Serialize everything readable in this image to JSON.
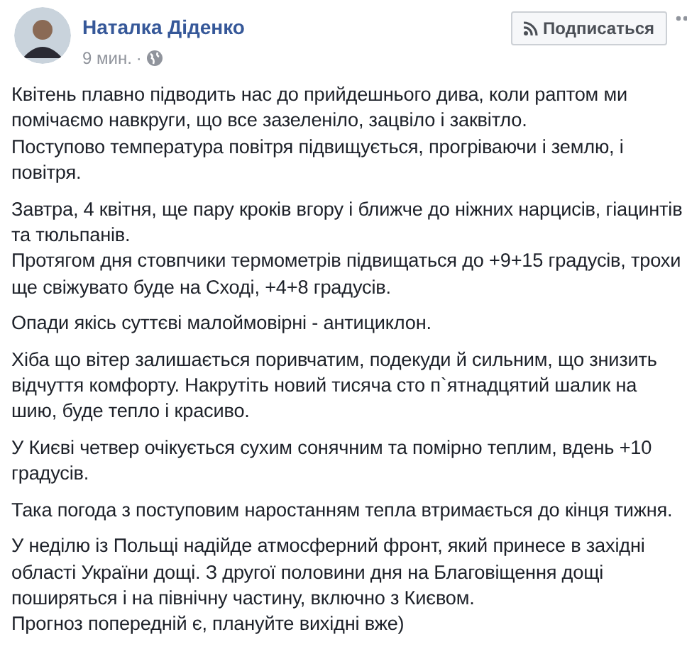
{
  "post": {
    "author": "Наталка Діденко",
    "time": "9 мин.",
    "separator": "·",
    "follow_button": "Подписаться",
    "paragraphs": [
      {
        "lines": [
          "Квітень плавно підводить нас до прийдешнього дива, коли раптом ми помічаємо навкруги, що все зазеленіло, зацвіло і заквітло.",
          "Поступово температура повітря підвищується, прогріваючи і землю, і повітря."
        ]
      },
      {
        "lines": [
          "Завтра, 4 квітня, ще пару кроків вгору і ближче до ніжних нарцисів, гіацинтів та тюльпанів.",
          "Протягом дня стовпчики термометрів підвищаться до +9+15 градусів, трохи ще свіжувато буде на Сході, +4+8 градусів."
        ]
      },
      {
        "lines": [
          "Опади якісь суттєві малоймовірні - антициклон."
        ]
      },
      {
        "lines": [
          "Хіба що вітер залишається поривчатим, подекуди й сильним, що знизить відчуття комфорту. Накрутіть новий тисяча сто п`ятнадцятий шалик на шию, буде тепло і красиво."
        ]
      },
      {
        "lines": [
          "У Києві четвер очікується сухим сонячним та помірно теплим, вдень +10 градусів."
        ]
      },
      {
        "lines": [
          "Така погода з поступовим наростанням тепла втримається до кінця тижня."
        ]
      },
      {
        "lines": [
          "У неділю із Польщі надійде атмосферний фронт, який принесе в західні області України дощі. З другої половини дня на Благовіщення дощі поширяться і на північну частину, включно з Києвом.",
          "Прогноз попередній є, плануйте вихідні вже)"
        ]
      }
    ]
  }
}
